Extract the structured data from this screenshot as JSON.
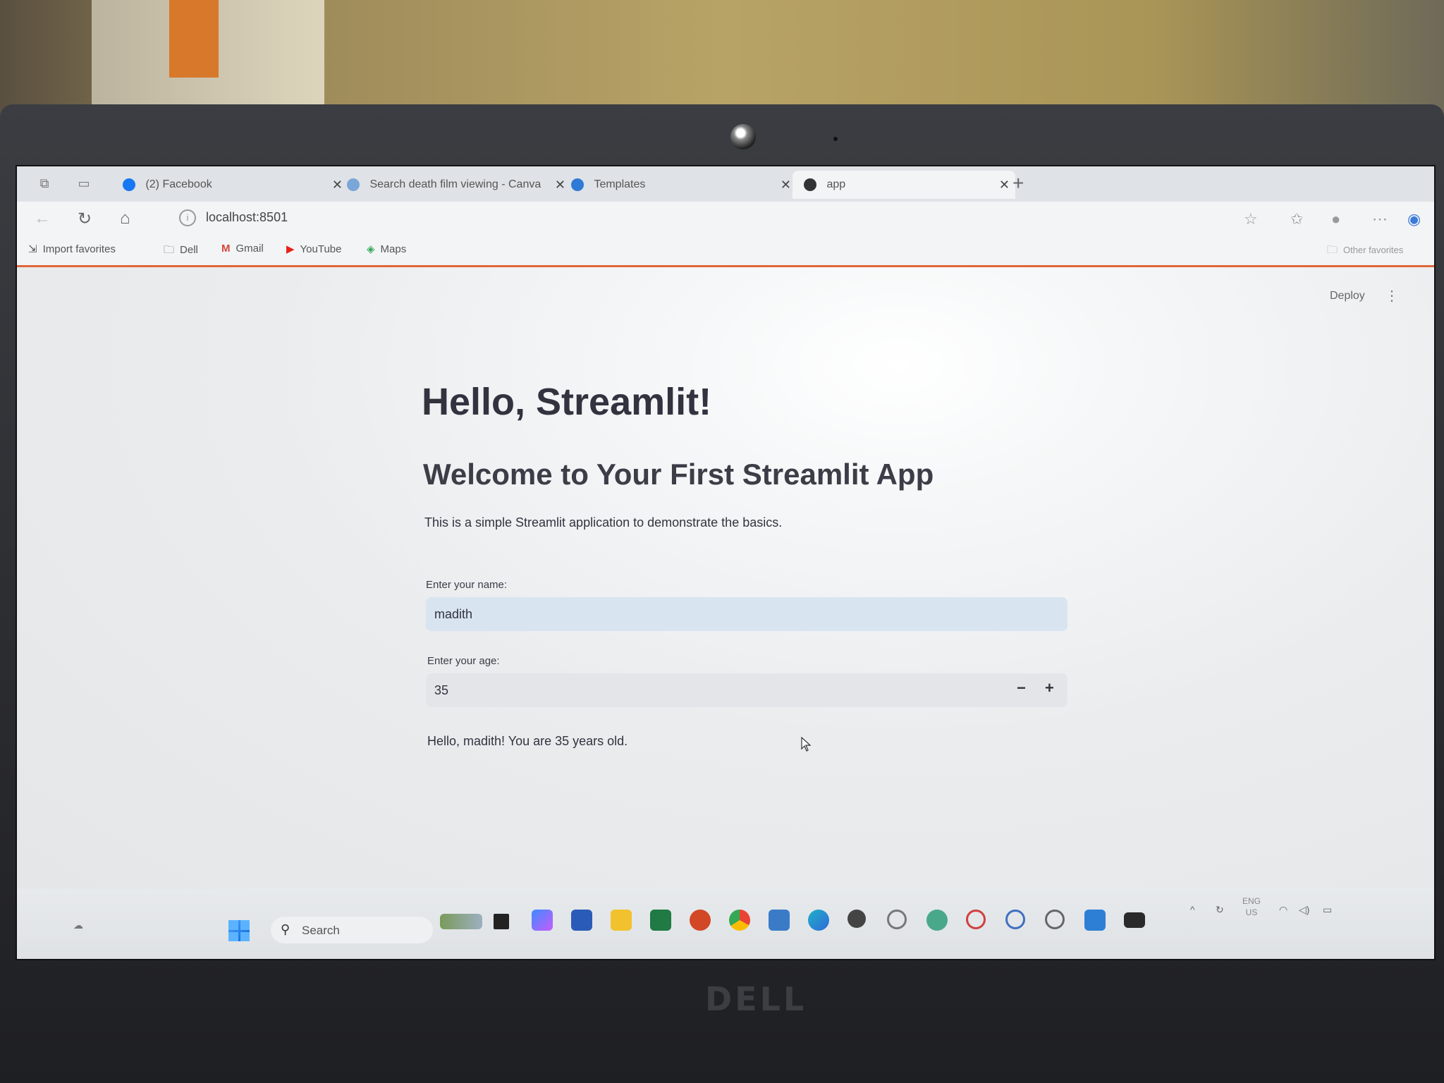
{
  "browser": {
    "tabs": [
      {
        "label": "(2) Facebook",
        "favicon_color": "#1877f2",
        "active": false
      },
      {
        "label": "Search death film viewing - Canva",
        "favicon_color": "#7aa6d8",
        "active": false
      },
      {
        "label": "Templates",
        "favicon_color": "#2e7bd6",
        "active": false
      },
      {
        "label": "app",
        "favicon_color": "#333333",
        "active": true
      }
    ],
    "new_tab_label": "+",
    "url": "localhost:8501",
    "favorites": [
      {
        "label": "Import favorites",
        "icon": "import-icon"
      },
      {
        "label": "Dell",
        "icon": "folder-icon"
      },
      {
        "label": "Gmail",
        "icon": "gmail-icon"
      },
      {
        "label": "YouTube",
        "icon": "youtube-icon"
      },
      {
        "label": "Maps",
        "icon": "maps-icon"
      }
    ],
    "other_favorites": "Other favorites"
  },
  "app": {
    "deploy_label": "Deploy",
    "title": "Hello, Streamlit!",
    "subtitle": "Welcome to Your First Streamlit App",
    "description": "This is a simple Streamlit application to demonstrate the basics.",
    "name_label": "Enter your name:",
    "name_value": "madith",
    "age_label": "Enter your age:",
    "age_value": "35",
    "decrement_label": "−",
    "increment_label": "+",
    "output": "Hello, madith! You are 35 years old."
  },
  "taskbar": {
    "search_label": "Search",
    "lang_top": "ENG",
    "lang_bottom": "US",
    "brand": "DELL"
  }
}
